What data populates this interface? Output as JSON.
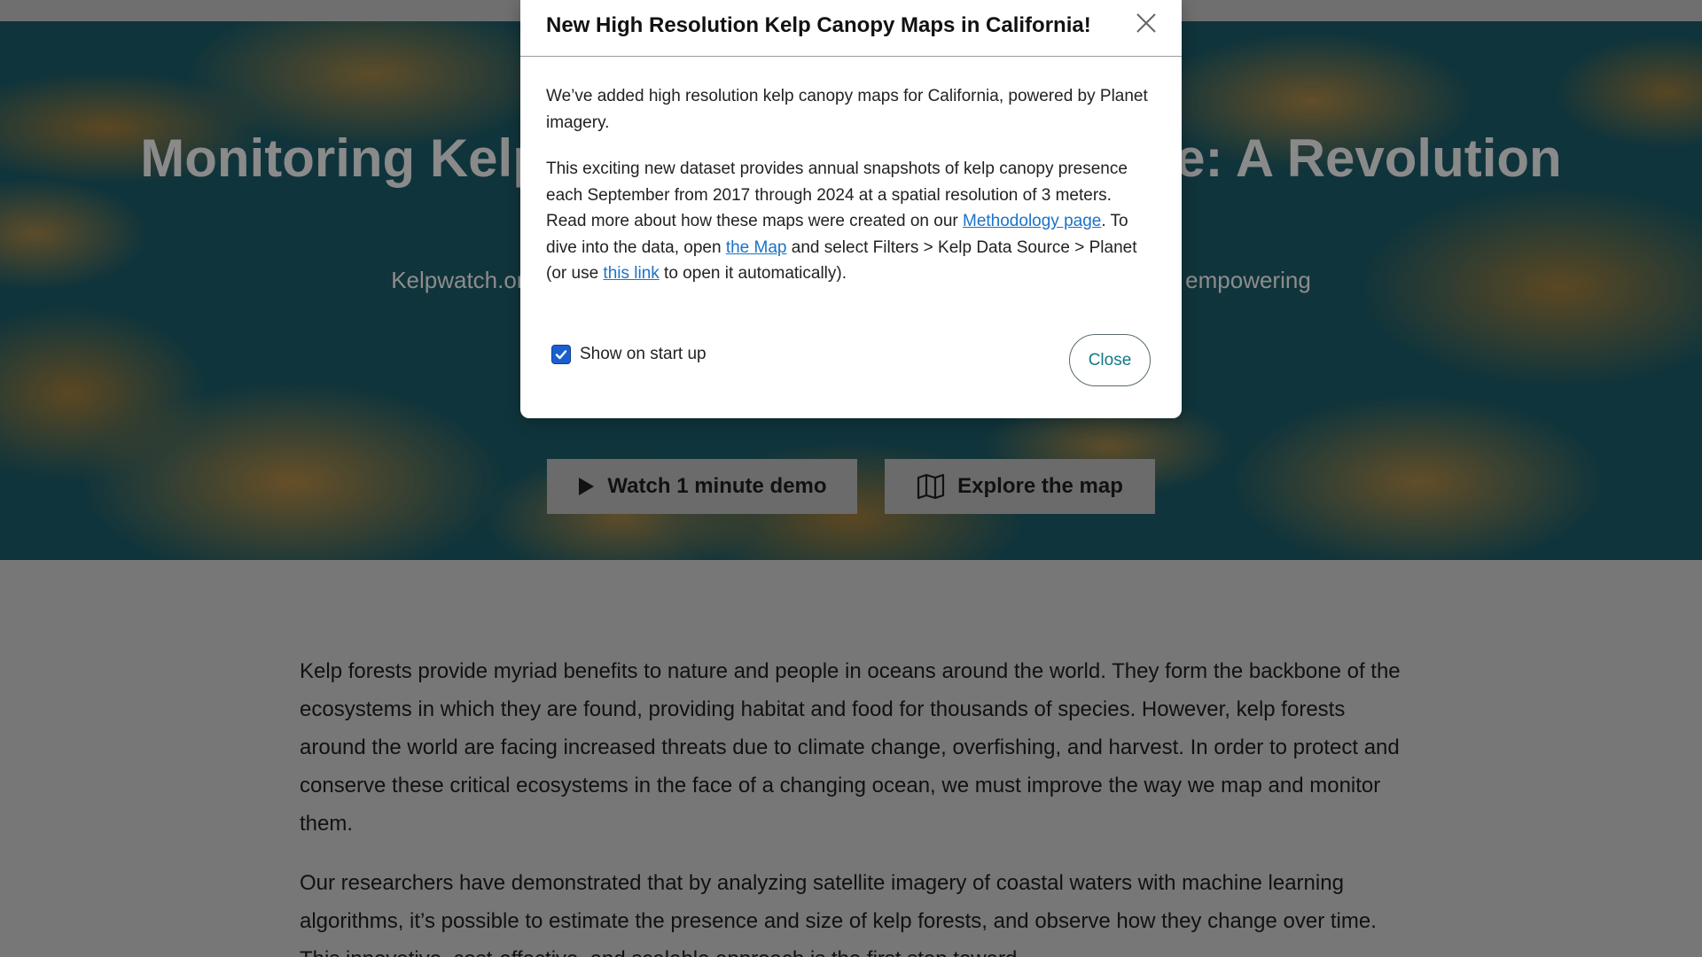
{
  "hero": {
    "title": "Monitoring Kelp Forests Across the Globe: A Revolution",
    "subtitle": "Kelpwatch.org uses satellite imagery to monitor canopy-forming kelp species, empowering decision-makers to protect and restore kelp forest ecosystems.",
    "demo_button_label": "Watch 1 minute demo",
    "map_button_label": "Explore the map"
  },
  "body": {
    "paragraph_1": "Kelp forests provide myriad benefits to nature and people in oceans around the world. They form the backbone of the ecosystems in which they are found, providing habitat and food for thousands of species. However, kelp forests around the world are facing increased threats due to climate change, overfishing, and harvest. In order to protect and conserve these critical ecosystems in the face of a changing ocean, we must improve the way we map and monitor them.",
    "paragraph_2": "Our researchers have demonstrated that by analyzing satellite imagery of coastal waters with machine learning algorithms, it’s possible to estimate the presence and size of kelp forests, and observe how they change over time. This innovative, cost-effective, and scalable approach is the first step toward"
  },
  "modal": {
    "title": "New High Resolution Kelp Canopy Maps in California!",
    "para_1": "We’ve added high resolution kelp canopy maps for California, powered by Planet imagery.",
    "para_2_a": "This exciting new dataset provides annual snapshots of kelp canopy presence each September from 2017 through 2024 at a spatial resolution of 3 meters. Read more about how these maps were created on our ",
    "link_methodology": "Methodology page",
    "para_2_b": ". To dive into the data, open ",
    "link_map": "the Map",
    "para_2_c": " and select Filters > Kelp Data Source > Planet (or use ",
    "link_this": "this link",
    "para_2_d": " to open it automatically).",
    "show_on_startup_label": "Show on start up",
    "show_on_startup_checked": true,
    "close_button_label": "Close"
  },
  "colors": {
    "accent_link": "#1a73c7",
    "close_button_text": "#127a86",
    "checkbox": "#1a5fd0"
  },
  "icons": {
    "modal_close": "close-x-icon",
    "demo": "play-icon",
    "map": "map-icon",
    "checkbox": "checkmark-icon"
  }
}
